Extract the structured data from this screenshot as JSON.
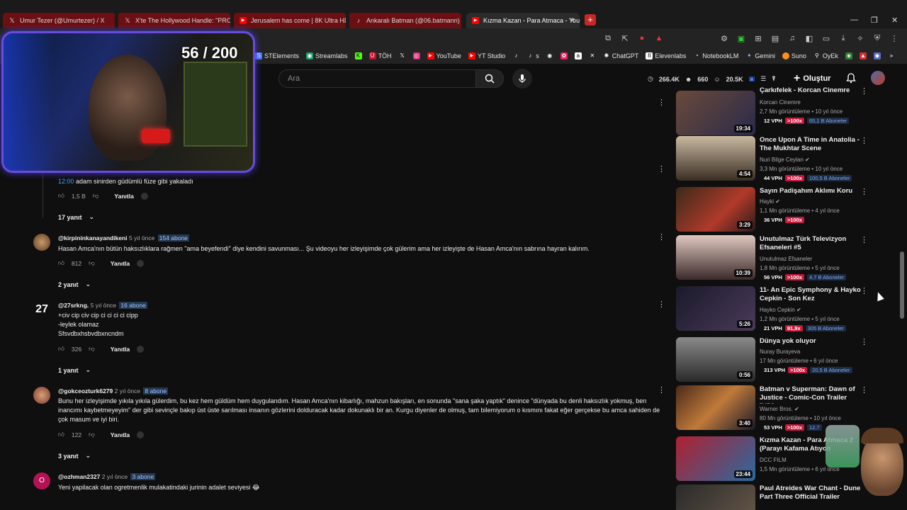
{
  "tabs": [
    {
      "label": "Umur Tezer (@Umurtezer) / X",
      "icon": "x-icon"
    },
    {
      "label": "X'te The Hollywood Handle: \"PROJE",
      "icon": "x-icon"
    },
    {
      "label": "Jerusalem has come | 8K Ultra HD Ci",
      "icon": "youtube-icon"
    },
    {
      "label": "Ankaralı Batman (@06.batmann) | Tik",
      "icon": "tiktok-icon"
    },
    {
      "label": "Kızma Kazan - Para Atmaca - You",
      "icon": "youtube-icon"
    }
  ],
  "window": {
    "minimize": "—",
    "maximize": "❐",
    "close": "✕",
    "new_tab": "+"
  },
  "bookmarks": [
    "STElements",
    "Streamlabs",
    "TÖH",
    "YouTube",
    "YT Studio",
    "s",
    "ChatGPT",
    "Elevenlabs",
    "NotebookLM",
    "Gemini",
    "Suno",
    "OyEk"
  ],
  "webcam": {
    "counter": "56 / 200"
  },
  "header": {
    "search_placeholder": "Ara",
    "stats": [
      "266.4K",
      "660",
      "20.5K"
    ],
    "create_label": "Oluştur"
  },
  "comments": [
    {
      "body": "adam sinirden güdümlü füze gibi yakaladı",
      "timestamp": "12:00",
      "likes": "1,5 B",
      "reply_label": "Yanıtla",
      "replies": "17 yanıt"
    },
    {
      "user": "@kirpininkanayandikeni",
      "time": "5 yıl önce",
      "badge": "154 abone",
      "body": "Hasan Amca'nın bütün haksızlıklara rağmen \"ama beyefendi\" diye kendini savunması... Şu videoyu her izleyişimde çok gülerim ama her izleyişte de Hasan Amca'nın sabrına hayran kalırım.",
      "likes": "812",
      "reply_label": "Yanıtla",
      "replies": "2 yanıt"
    },
    {
      "user": "@27srkng.",
      "time": "5 yıl önce",
      "badge": "16 abone",
      "avatar_text": "27",
      "body_lines": [
        "+civ cip civ cip ci ci ci ci cipp",
        "-leylek olamaz",
        "Sfsvdbxhsbvdbxncndm"
      ],
      "likes": "326",
      "reply_label": "Yanıtla",
      "replies": "1 yanıt"
    },
    {
      "user": "@gokceozturk6279",
      "time": "2 yıl önce",
      "badge": "8 abone",
      "body": "Bunu her izleyişimde yıkıla yıkıla gülerdim, bu kez hem güldüm hem duygulandım. Hasan Amca'nın kibarlığı, mahzun bakışları, en sonunda \"sana şaka yaptık\" denince \"dünyada bu denli haksızlık yokmuş, ben inancımı kaybetmeyeyim\" der gibi sevinçle bakıp üst üste sarılması insanın gözlerini dolduracak kadar dokunaklı bir an. Kurgu diyenler de olmuş, tam bilemiyorum o kısmını fakat eğer gerçekse bu amca sahiden de çok masum ve iyi biri.",
      "likes": "122",
      "reply_label": "Yanıtla",
      "replies": "3 yanıt"
    },
    {
      "user": "@ozhman2327",
      "time": "2 yıl önce",
      "badge": "3 abone",
      "avatar_text": "O",
      "body": "Yeni yapilacak olan ogretmenlik mulakatindaki jurinin adalet seviyesi 😂"
    }
  ],
  "related": [
    {
      "title": "Çarkıfelek - Korcan Cinemre",
      "channel": "Korcan Cinemre",
      "meta": "2,7 Mn görüntüleme • 10 yıl önce",
      "vph": "12 VPH",
      "hot": ">100x",
      "subs": "65,1 B Aboneler",
      "duration": "19:34"
    },
    {
      "title": "Once Upon A Time in Anatolia - The Mukhtar Scene",
      "channel": "Nuri Bilge Ceylan",
      "verified": true,
      "meta": "3,3 Mn görüntüleme • 10 yıl önce",
      "vph": "44 VPH",
      "hot": ">100x",
      "subs": "100,5 B Aboneler",
      "duration": "4:54"
    },
    {
      "title": "Sayın Padişahım Aklımı Koru",
      "channel": "Hayki",
      "verified": true,
      "meta": "1,1 Mn görüntüleme • 4 yıl önce",
      "vph": "36 VPH",
      "hot": ">100x",
      "duration": "3:29"
    },
    {
      "title": "Unutulmaz Türk Televizyon Efsaneleri #5",
      "channel": "Unutulmaz Efsaneler",
      "meta": "1,8 Mn görüntüleme • 5 yıl önce",
      "vph": "56 VPH",
      "hot": ">100x",
      "subs": "4,7 B Aboneler",
      "duration": "10:39"
    },
    {
      "title": "11- An Epic Symphony & Hayko Cepkin - Son Kez",
      "channel": "Hayko Cepkin",
      "verified": true,
      "meta": "1,2 Mn görüntüleme • 5 yıl önce",
      "vph": "21 VPH",
      "hot": "91,9x",
      "subs": "305 B Aboneler",
      "duration": "5:26"
    },
    {
      "title": "Dünya yok oluyor",
      "channel": "Nuray Burayeva",
      "meta": "17 Mn görüntüleme • 6 yıl önce",
      "vph": "313 VPH",
      "hot": ">100x",
      "subs": "20,5 B Aboneler",
      "duration": "0:56"
    },
    {
      "title": "Batman v Superman: Dawn of Justice - Comic-Con Trailer [HD]",
      "channel": "Warner Bros.",
      "verified": true,
      "meta": "80 Mn görüntüleme • 10 yıl önce",
      "vph": "53 VPH",
      "hot": ">100x",
      "subs": "12,7",
      "duration": "3:40"
    },
    {
      "title": "Kızma Kazan - Para Atmaca 2 (Parayı Kafama Atıyon",
      "channel": "DCC FILM",
      "meta": "1,5 Mn görüntüleme • 6 yıl önce",
      "duration": "23:44"
    },
    {
      "title": "Paul Atreides War Chant - Dune Part Three Official Trailer"
    }
  ]
}
